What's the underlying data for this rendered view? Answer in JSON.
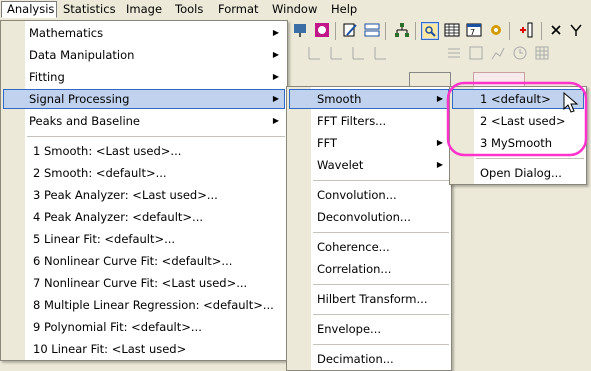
{
  "menubar": {
    "items": [
      "Analysis",
      "Statistics",
      "Image",
      "Tools",
      "Format",
      "Window",
      "Help"
    ]
  },
  "analysis_menu": {
    "items": [
      {
        "label": "Mathematics",
        "submenu": true
      },
      {
        "label": "Data Manipulation",
        "submenu": true
      },
      {
        "label": "Fitting",
        "submenu": true
      },
      {
        "label": "Signal Processing",
        "submenu": true
      },
      {
        "label": "Peaks and Baseline",
        "submenu": true
      }
    ],
    "recent": [
      "1 Smooth: <Last used>...",
      "2 Smooth: <default>...",
      "3 Peak Analyzer: <Last used>...",
      "4 Peak Analyzer: <default>...",
      "5 Linear Fit: <default>...",
      "6 Nonlinear Curve Fit: <default>...",
      "7 Nonlinear Curve Fit: <Last used>...",
      "8 Multiple Linear Regression: <default>...",
      "9 Polynomial Fit: <default>...",
      "10 Linear Fit: <Last used>"
    ]
  },
  "signal_menu": {
    "items": [
      "Smooth",
      "FFT Filters...",
      "FFT",
      "Wavelet",
      "Convolution...",
      "Deconvolution...",
      "Coherence...",
      "Correlation...",
      "Hilbert Transform...",
      "Envelope...",
      "Decimation..."
    ]
  },
  "smooth_menu": {
    "items": [
      "1 <default>",
      "2 <Last used>",
      "3 MySmooth",
      "Open Dialog..."
    ]
  },
  "colors": {
    "highlight_bg": "#c1d2ee",
    "highlight_border": "#316ac5",
    "annotation": "#ff33cc"
  }
}
